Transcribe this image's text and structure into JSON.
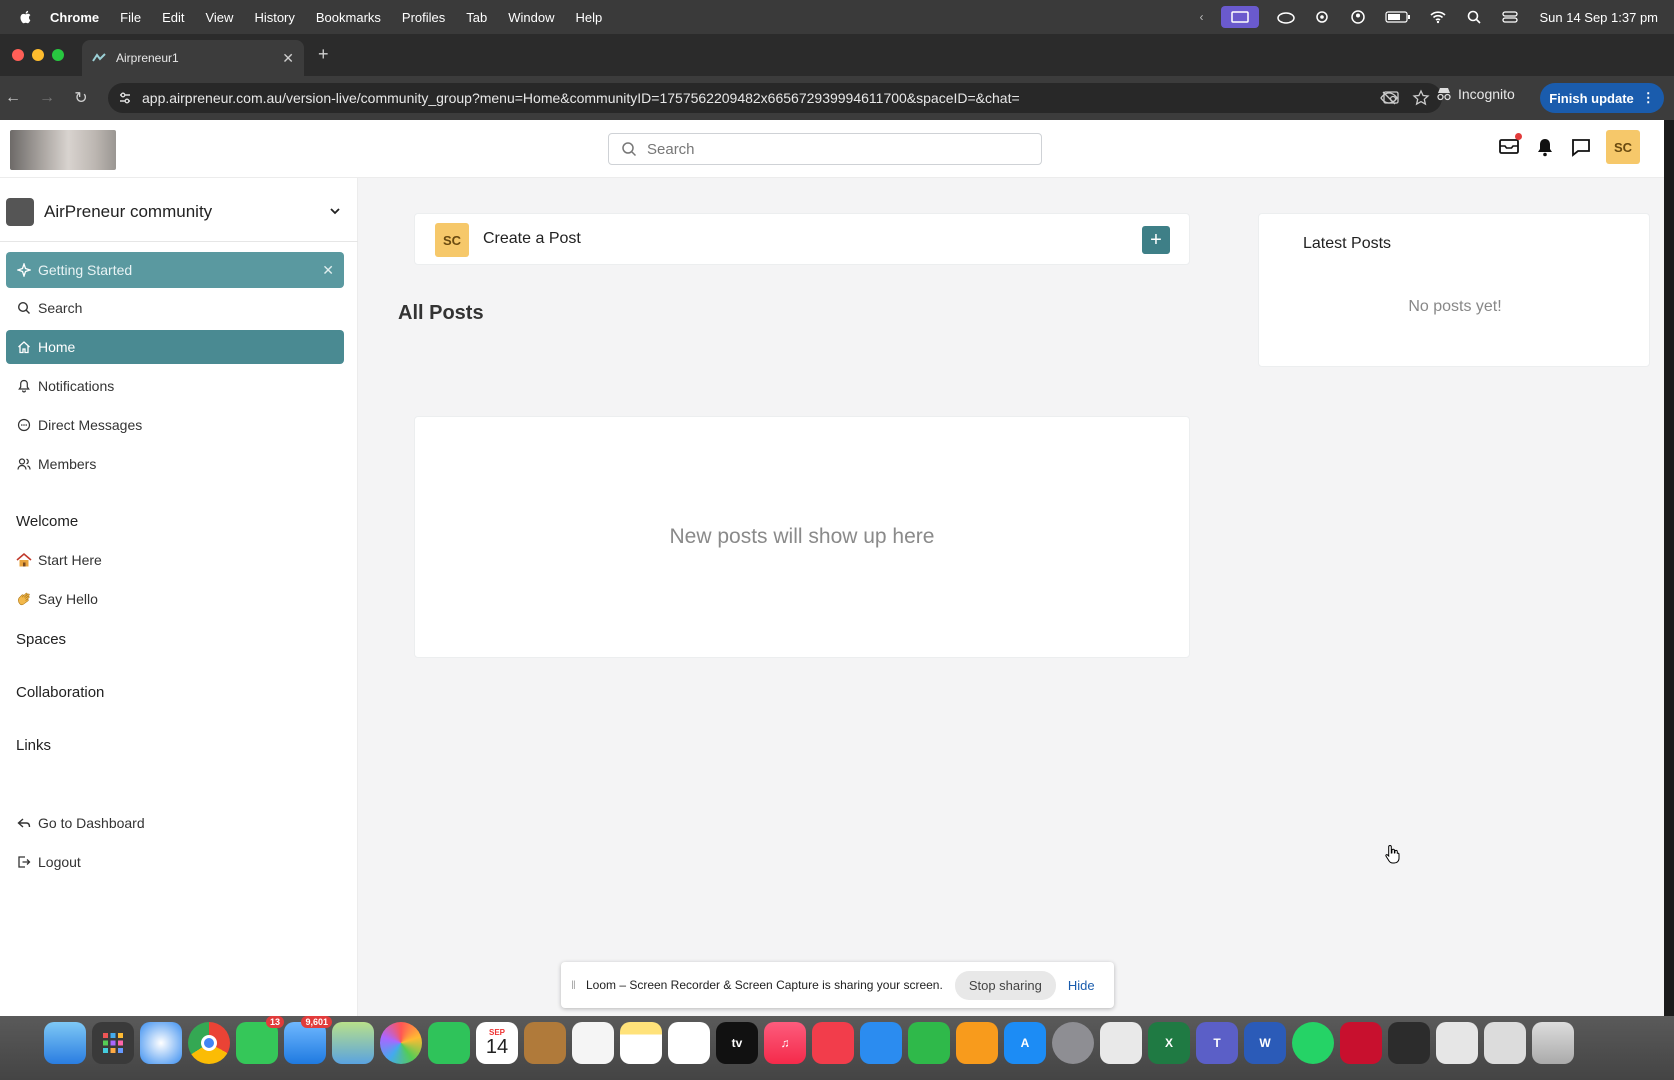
{
  "os": {
    "menubar": {
      "app": "Chrome",
      "menus": [
        "File",
        "Edit",
        "View",
        "History",
        "Bookmarks",
        "Profiles",
        "Tab",
        "Window",
        "Help"
      ],
      "clock": "Sun 14 Sep  1:37 pm"
    }
  },
  "browser": {
    "tab_title": "Airpreneur1",
    "url": "app.airpreneur.com.au/version-live/community_group?menu=Home&communityID=1757562209482x665672939994611700&spaceID=&chat=",
    "incognito_label": "Incognito",
    "finish_update_label": "Finish update"
  },
  "app": {
    "search_placeholder": "Search",
    "user_initials": "SC",
    "sidebar": {
      "community_name": "AirPreneur community",
      "getting_started": "Getting Started",
      "nav": [
        {
          "label": "Search",
          "icon": "search-icon"
        },
        {
          "label": "Home",
          "icon": "home-icon"
        },
        {
          "label": "Notifications",
          "icon": "bell-icon"
        },
        {
          "label": "Direct Messages",
          "icon": "chat-icon"
        },
        {
          "label": "Members",
          "icon": "members-icon"
        }
      ],
      "welcome_heading": "Welcome",
      "welcome_items": [
        {
          "label": "Start Here",
          "icon": "house-emoji-icon"
        },
        {
          "label": "Say Hello",
          "icon": "wave-emoji-icon"
        }
      ],
      "spaces_heading": "Spaces",
      "collaboration_heading": "Collaboration",
      "links_heading": "Links",
      "dashboard_label": "Go to Dashboard",
      "logout_label": "Logout"
    },
    "main": {
      "create_post_label": "Create a Post",
      "all_posts_heading": "All Posts",
      "empty_message": "New posts will show up here"
    },
    "latest": {
      "title": "Latest Posts",
      "empty": "No posts yet!"
    }
  },
  "loom": {
    "message": "Loom – Screen Recorder & Screen Capture is sharing your screen.",
    "stop_label": "Stop sharing",
    "hide_label": "Hide"
  },
  "dock": {
    "calendar_month": "SEP",
    "calendar_day": "14",
    "messages_badge": "13",
    "mail_badge": "9,601"
  },
  "colors": {
    "accent": "#4a8a92",
    "avatar": "#f6c86a",
    "chrome_update": "#1a5cad"
  }
}
